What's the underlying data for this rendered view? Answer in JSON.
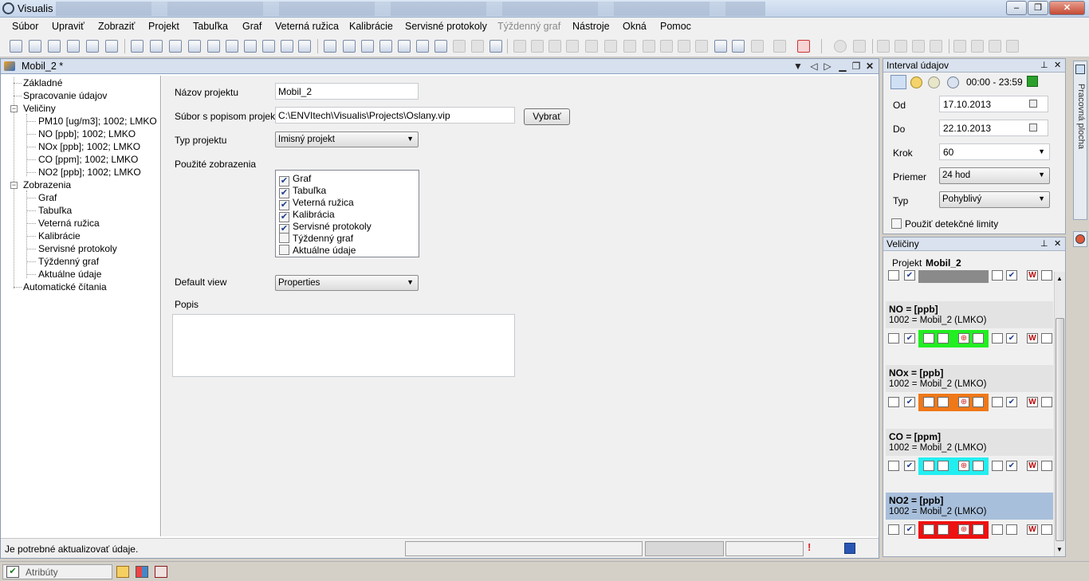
{
  "window": {
    "title": "Visualis"
  },
  "menu": [
    "Súbor",
    "Upraviť",
    "Zobraziť",
    "Projekt",
    "Tabuľka",
    "Graf",
    "Veterná ružica",
    "Kalibrácie",
    "Servisné protokoly",
    "Týždenný graf",
    "Nástroje",
    "Okná",
    "Pomoc"
  ],
  "menu_disabled": [
    "Týždenný graf"
  ],
  "document": {
    "title": "Mobil_2 *"
  },
  "tree": {
    "items": [
      "Základné",
      "Spracovanie údajov",
      "Veličiny",
      "PM10 [ug/m3]; 1002; LMKO",
      "NO [ppb]; 1002; LMKO",
      "NOx [ppb]; 1002; LMKO",
      "CO [ppm]; 1002; LMKO",
      "NO2 [ppb]; 1002; LMKO",
      "Zobrazenia",
      "Graf",
      "Tabuľka",
      "Veterná ružica",
      "Kalibrácie",
      "Servisné protokoly",
      "Týždenný graf",
      "Aktuálne údaje",
      "Automatické čítania"
    ]
  },
  "form": {
    "project_name_label": "Názov projektu",
    "project_name_value": "Mobil_2",
    "project_file_label": "Súbor s popisom projektu",
    "project_file_value": "C:\\ENVItech\\Visualis\\Projects\\Oslany.vip",
    "browse_button": "Vybrať",
    "project_type_label": "Typ projektu",
    "project_type_value": "Imisný projekt",
    "views_label": "Použité zobrazenia",
    "views": [
      {
        "label": "Graf",
        "checked": true
      },
      {
        "label": "Tabuľka",
        "checked": true
      },
      {
        "label": "Veterná ružica",
        "checked": true
      },
      {
        "label": "Kalibrácia",
        "checked": true
      },
      {
        "label": "Servisné protokoly",
        "checked": true
      },
      {
        "label": "Týždenný graf",
        "checked": false
      },
      {
        "label": "Aktuálne údaje",
        "checked": false
      }
    ],
    "default_view_label": "Default view",
    "default_view_value": "Properties",
    "description_label": "Popis"
  },
  "status": {
    "message": "Je potrebné aktualizovať údaje."
  },
  "interval": {
    "title": "Interval údajov",
    "time_range": "00:00 - 23:59",
    "from_label": "Od",
    "from_value": "17.10.2013",
    "to_label": "Do",
    "to_value": "22.10.2013",
    "step_label": "Krok",
    "step_value": "60",
    "average_label": "Priemer",
    "average_value": "24 hod",
    "type_label": "Typ",
    "type_value": "Pohyblivý",
    "detection_label": "Použiť detekčné limity",
    "detection_checked": false
  },
  "quantities": {
    "title": "Veličiny",
    "project_label": "Projekt",
    "project_value": "Mobil_2",
    "items": [
      {
        "name": "NO =  [ppb]",
        "source": "1002 = Mobil_2 (LMKO)",
        "color": "#22ee22",
        "selected": false
      },
      {
        "name": "NOx =  [ppb]",
        "source": "1002 = Mobil_2 (LMKO)",
        "color": "#f07818",
        "selected": false
      },
      {
        "name": "CO =  [ppm]",
        "source": "1002 = Mobil_2 (LMKO)",
        "color": "#22eef0",
        "selected": false
      },
      {
        "name": "NO2 =  [ppb]",
        "source": "1002 = Mobil_2 (LMKO)",
        "color": "#ee1111",
        "selected": true
      }
    ],
    "first_color": "#8a8a8a"
  },
  "side_tab": {
    "label": "Pracovná plocha"
  },
  "bottom": {
    "attributes_label": "Atribúty"
  }
}
